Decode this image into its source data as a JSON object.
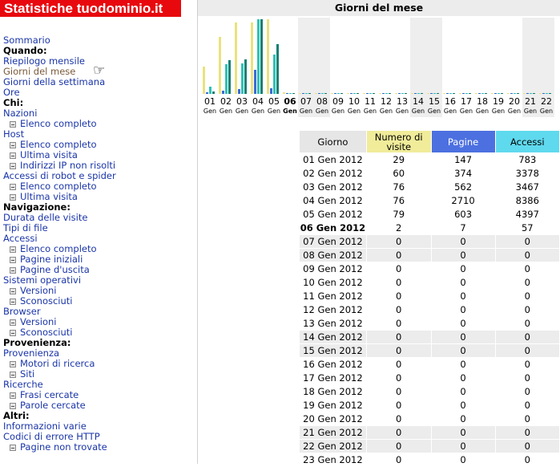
{
  "brand": "Statistiche tuodominio.it",
  "title": "Giorni del mese",
  "menu": [
    {
      "type": "link",
      "label": "Sommario"
    },
    {
      "type": "head",
      "label": "Quando:"
    },
    {
      "type": "link",
      "label": "Riepilogo mensile"
    },
    {
      "type": "link",
      "label": "Giorni del mese",
      "visited": true
    },
    {
      "type": "link",
      "label": "Giorni della settimana"
    },
    {
      "type": "link",
      "label": "Ore"
    },
    {
      "type": "head",
      "label": "Chi:"
    },
    {
      "type": "link",
      "label": "Nazioni"
    },
    {
      "type": "sub",
      "label": "Elenco completo"
    },
    {
      "type": "link",
      "label": "Host"
    },
    {
      "type": "sub",
      "label": "Elenco completo"
    },
    {
      "type": "sub",
      "label": "Ultima visita"
    },
    {
      "type": "sub",
      "label": "Indirizzi IP non risolti"
    },
    {
      "type": "link",
      "label": "Accessi di robot e spider"
    },
    {
      "type": "sub",
      "label": "Elenco completo"
    },
    {
      "type": "sub",
      "label": "Ultima visita"
    },
    {
      "type": "head",
      "label": "Navigazione:"
    },
    {
      "type": "link",
      "label": "Durata delle visite"
    },
    {
      "type": "link",
      "label": "Tipi di file"
    },
    {
      "type": "link",
      "label": "Accessi"
    },
    {
      "type": "sub",
      "label": "Elenco completo"
    },
    {
      "type": "sub",
      "label": "Pagine iniziali"
    },
    {
      "type": "sub",
      "label": "Pagine d'uscita"
    },
    {
      "type": "link",
      "label": "Sistemi operativi"
    },
    {
      "type": "sub",
      "label": "Versioni"
    },
    {
      "type": "sub",
      "label": "Sconosciuti"
    },
    {
      "type": "link",
      "label": "Browser"
    },
    {
      "type": "sub",
      "label": "Versioni"
    },
    {
      "type": "sub",
      "label": "Sconosciuti"
    },
    {
      "type": "head",
      "label": "Provenienza:"
    },
    {
      "type": "link",
      "label": "Provenienza"
    },
    {
      "type": "sub",
      "label": "Motori di ricerca"
    },
    {
      "type": "sub",
      "label": "Siti"
    },
    {
      "type": "link",
      "label": "Ricerche"
    },
    {
      "type": "sub",
      "label": "Frasi cercate"
    },
    {
      "type": "sub",
      "label": "Parole cercate"
    },
    {
      "type": "head",
      "label": "Altri:"
    },
    {
      "type": "link",
      "label": "Informazioni varie"
    },
    {
      "type": "link",
      "label": "Codici di errore HTTP"
    },
    {
      "type": "sub",
      "label": "Pagine non trovate"
    }
  ],
  "colors": {
    "visite": "#e9e27f",
    "pagine": "#3d6bd6",
    "accessi": "#2fc2b7",
    "hits": "#0f7f73",
    "title_bg": "#ececec",
    "brand_bg": "#e8090e"
  },
  "chart_data": {
    "type": "bar",
    "max": {
      "visite": 79,
      "pagine": 2710,
      "accessi": 8386
    },
    "days": [
      {
        "num": "01",
        "mon": "Gen",
        "visite": 29,
        "pagine": 147,
        "accessi": 783,
        "hits": 300,
        "shade": false
      },
      {
        "num": "02",
        "mon": "Gen",
        "visite": 60,
        "pagine": 374,
        "accessi": 3378,
        "hits": 3800,
        "shade": false
      },
      {
        "num": "03",
        "mon": "Gen",
        "visite": 76,
        "pagine": 562,
        "accessi": 3467,
        "hits": 3900,
        "shade": false
      },
      {
        "num": "04",
        "mon": "Gen",
        "visite": 76,
        "pagine": 2710,
        "accessi": 8386,
        "hits": 8386,
        "shade": false
      },
      {
        "num": "05",
        "mon": "Gen",
        "visite": 79,
        "pagine": 603,
        "accessi": 4397,
        "hits": 5600,
        "shade": false
      },
      {
        "num": "06",
        "mon": "Gen",
        "visite": 2,
        "pagine": 7,
        "accessi": 57,
        "hits": 80,
        "shade": false,
        "today": true
      },
      {
        "num": "07",
        "mon": "Gen",
        "visite": 0,
        "pagine": 0,
        "accessi": 0,
        "hits": 0,
        "shade": true
      },
      {
        "num": "08",
        "mon": "Gen",
        "visite": 0,
        "pagine": 0,
        "accessi": 0,
        "hits": 0,
        "shade": true
      },
      {
        "num": "09",
        "mon": "Gen",
        "visite": 0,
        "pagine": 0,
        "accessi": 0,
        "hits": 0,
        "shade": false
      },
      {
        "num": "10",
        "mon": "Gen",
        "visite": 0,
        "pagine": 0,
        "accessi": 0,
        "hits": 0,
        "shade": false
      },
      {
        "num": "11",
        "mon": "Gen",
        "visite": 0,
        "pagine": 0,
        "accessi": 0,
        "hits": 0,
        "shade": false
      },
      {
        "num": "12",
        "mon": "Gen",
        "visite": 0,
        "pagine": 0,
        "accessi": 0,
        "hits": 0,
        "shade": false
      },
      {
        "num": "13",
        "mon": "Gen",
        "visite": 0,
        "pagine": 0,
        "accessi": 0,
        "hits": 0,
        "shade": false
      },
      {
        "num": "14",
        "mon": "Gen",
        "visite": 0,
        "pagine": 0,
        "accessi": 0,
        "hits": 0,
        "shade": true
      },
      {
        "num": "15",
        "mon": "Gen",
        "visite": 0,
        "pagine": 0,
        "accessi": 0,
        "hits": 0,
        "shade": true
      },
      {
        "num": "16",
        "mon": "Gen",
        "visite": 0,
        "pagine": 0,
        "accessi": 0,
        "hits": 0,
        "shade": false
      },
      {
        "num": "17",
        "mon": "Gen",
        "visite": 0,
        "pagine": 0,
        "accessi": 0,
        "hits": 0,
        "shade": false
      },
      {
        "num": "18",
        "mon": "Gen",
        "visite": 0,
        "pagine": 0,
        "accessi": 0,
        "hits": 0,
        "shade": false
      },
      {
        "num": "19",
        "mon": "Gen",
        "visite": 0,
        "pagine": 0,
        "accessi": 0,
        "hits": 0,
        "shade": false
      },
      {
        "num": "20",
        "mon": "Gen",
        "visite": 0,
        "pagine": 0,
        "accessi": 0,
        "hits": 0,
        "shade": false
      },
      {
        "num": "21",
        "mon": "Gen",
        "visite": 0,
        "pagine": 0,
        "accessi": 0,
        "hits": 0,
        "shade": true
      },
      {
        "num": "22",
        "mon": "Gen",
        "visite": 0,
        "pagine": 0,
        "accessi": 0,
        "hits": 0,
        "shade": true
      }
    ]
  },
  "table": {
    "headers": {
      "giorno": "Giorno",
      "visite": "Numero di visite",
      "pagine": "Pagine",
      "accessi": "Accessi"
    },
    "rows": [
      {
        "giorno": "01 Gen 2012",
        "visite": "29",
        "pagine": "147",
        "accessi": "783"
      },
      {
        "giorno": "02 Gen 2012",
        "visite": "60",
        "pagine": "374",
        "accessi": "3378"
      },
      {
        "giorno": "03 Gen 2012",
        "visite": "76",
        "pagine": "562",
        "accessi": "3467"
      },
      {
        "giorno": "04 Gen 2012",
        "visite": "76",
        "pagine": "2710",
        "accessi": "8386"
      },
      {
        "giorno": "05 Gen 2012",
        "visite": "79",
        "pagine": "603",
        "accessi": "4397"
      },
      {
        "giorno": "06 Gen 2012",
        "visite": "2",
        "pagine": "7",
        "accessi": "57",
        "today": true
      },
      {
        "giorno": "07 Gen 2012",
        "visite": "0",
        "pagine": "0",
        "accessi": "0",
        "shade": true
      },
      {
        "giorno": "08 Gen 2012",
        "visite": "0",
        "pagine": "0",
        "accessi": "0",
        "shade": true
      },
      {
        "giorno": "09 Gen 2012",
        "visite": "0",
        "pagine": "0",
        "accessi": "0"
      },
      {
        "giorno": "10 Gen 2012",
        "visite": "0",
        "pagine": "0",
        "accessi": "0"
      },
      {
        "giorno": "11 Gen 2012",
        "visite": "0",
        "pagine": "0",
        "accessi": "0"
      },
      {
        "giorno": "12 Gen 2012",
        "visite": "0",
        "pagine": "0",
        "accessi": "0"
      },
      {
        "giorno": "13 Gen 2012",
        "visite": "0",
        "pagine": "0",
        "accessi": "0"
      },
      {
        "giorno": "14 Gen 2012",
        "visite": "0",
        "pagine": "0",
        "accessi": "0",
        "shade": true
      },
      {
        "giorno": "15 Gen 2012",
        "visite": "0",
        "pagine": "0",
        "accessi": "0",
        "shade": true
      },
      {
        "giorno": "16 Gen 2012",
        "visite": "0",
        "pagine": "0",
        "accessi": "0"
      },
      {
        "giorno": "17 Gen 2012",
        "visite": "0",
        "pagine": "0",
        "accessi": "0"
      },
      {
        "giorno": "18 Gen 2012",
        "visite": "0",
        "pagine": "0",
        "accessi": "0"
      },
      {
        "giorno": "19 Gen 2012",
        "visite": "0",
        "pagine": "0",
        "accessi": "0"
      },
      {
        "giorno": "20 Gen 2012",
        "visite": "0",
        "pagine": "0",
        "accessi": "0"
      },
      {
        "giorno": "21 Gen 2012",
        "visite": "0",
        "pagine": "0",
        "accessi": "0",
        "shade": true
      },
      {
        "giorno": "22 Gen 2012",
        "visite": "0",
        "pagine": "0",
        "accessi": "0",
        "shade": true
      },
      {
        "giorno": "23 Gen 2012",
        "visite": "0",
        "pagine": "0",
        "accessi": "0"
      }
    ]
  }
}
